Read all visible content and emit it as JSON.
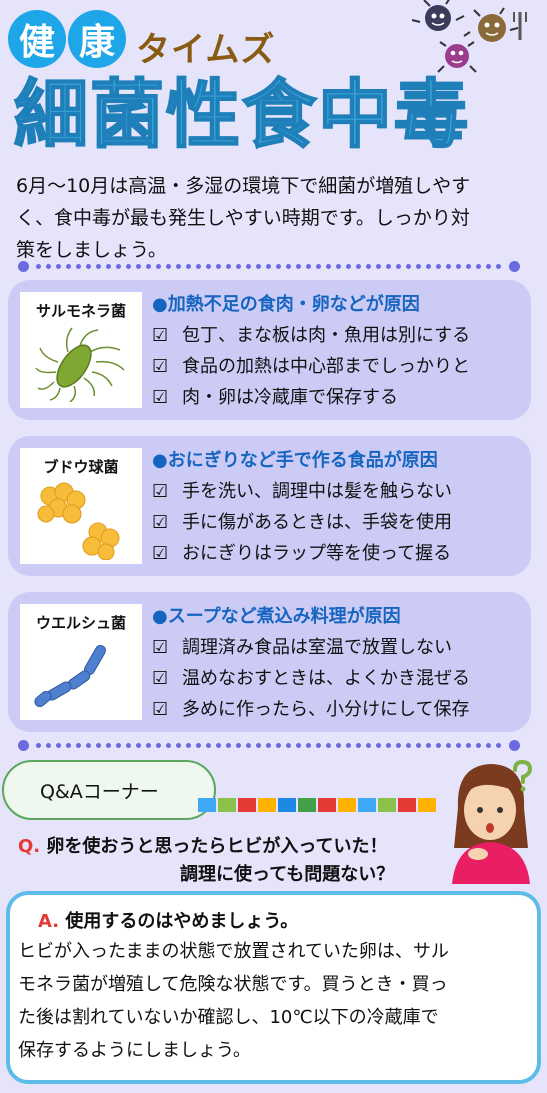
{
  "header": {
    "kanji1": "健",
    "kanji2": "康",
    "times": "タイムズ",
    "title": "細菌性食中毒"
  },
  "intro": [
    "6月〜10月は高温・多湿の環境下で細菌が増殖しやす",
    "く、食中毒が最も発生しやすい時期です。しっかり対",
    "策をしましょう。"
  ],
  "cards": [
    {
      "name": "サルモネラ菌",
      "cause": "●加熱不足の食肉・卵などが原因",
      "items": [
        "包丁、まな板は肉・魚用は別にする",
        "食品の加熱は中心部までしっかりと",
        "肉・卵は冷蔵庫で保存する"
      ]
    },
    {
      "name": "ブドウ球菌",
      "cause": "●おにぎりなど手で作る食品が原因",
      "items": [
        "手を洗い、調理中は髪を触らない",
        "手に傷があるときは、手袋を使用",
        "おにぎりはラップ等を使って握る"
      ]
    },
    {
      "name": "ウエルシュ菌",
      "cause": "●スープなど煮込み料理が原因",
      "items": [
        "調理済み食品は室温で放置しない",
        "温めなおすときは、よくかき混ぜる",
        "多めに作ったら、小分けにして保存"
      ]
    }
  ],
  "check_glyph": "☑",
  "qa": {
    "label": "Q&Aコーナー",
    "q_mark": "Q.",
    "q_line1": "卵を使おうと思ったらヒビが入っていた！",
    "q_line2": "調理に使っても問題ない？",
    "a_mark": "A.",
    "a_title": "使用するのはやめましょう。",
    "a_lines": [
      "ヒビが入ったままの状態で放置されていた卵は、サル",
      "モネラ菌が増殖して危険な状態です。買うとき・買っ",
      "た後は割れていないか確認し、10℃以下の冷蔵庫で",
      "保存するようにしましょう。"
    ]
  },
  "colors": {
    "background": "#e6e4fb",
    "kanji_circle": "#1ea6e8",
    "times_text": "#8a5b12",
    "title_text": "#3aa3dd",
    "card_bg": "#cccbf6",
    "cause_text": "#1565c0",
    "dotted_line": "#6c6ae0",
    "answer_border": "#5dbde8",
    "qa_mark": "#e53935"
  },
  "icons": [
    "germ-character-icon",
    "salmonella-bacteria-icon",
    "staphylococcus-bacteria-icon",
    "clostridium-bacteria-icon",
    "book-row-icon",
    "thinking-girl-icon",
    "question-mark-icon"
  ]
}
